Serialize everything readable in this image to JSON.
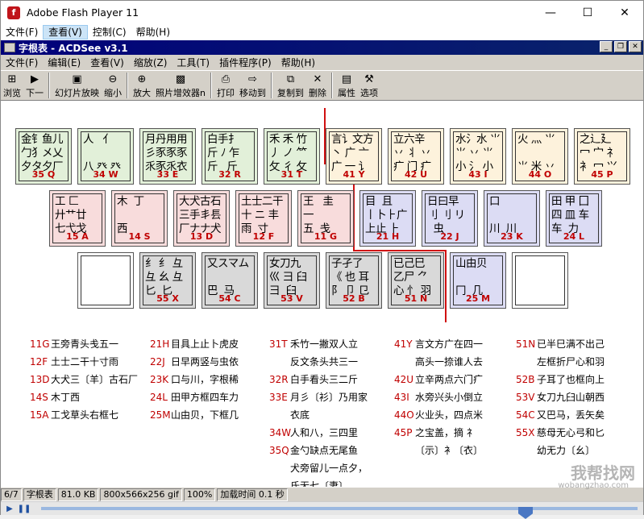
{
  "window": {
    "title": "Adobe Flash Player 11",
    "menu": [
      "文件(F)",
      "查看(V)",
      "控制(C)",
      "帮助(H)"
    ],
    "controls": {
      "minimize": "—",
      "maximize": "☐",
      "close": "✕"
    }
  },
  "acdsee": {
    "title": "字根表 - ACDSee v3.1",
    "menu": [
      "文件(F)",
      "编辑(E)",
      "查看(V)",
      "缩放(Z)",
      "工具(T)",
      "插件程序(P)",
      "帮助(H)"
    ],
    "toolbar": [
      {
        "label": "浏览",
        "icon": "browse-icon",
        "glyph": "⊞"
      },
      {
        "label": "下一",
        "icon": "next-icon",
        "glyph": "▶"
      },
      {
        "label": "幻灯片放映",
        "icon": "slideshow-icon",
        "glyph": "▣"
      },
      {
        "label": "缩小",
        "icon": "zoom-out-icon",
        "glyph": "⊖"
      },
      {
        "label": "放大",
        "icon": "zoom-in-icon",
        "glyph": "⊕"
      },
      {
        "label": "照片增效器n",
        "icon": "photo-enhancer-icon",
        "glyph": "▩"
      },
      {
        "label": "打印",
        "icon": "print-icon",
        "glyph": "⎙"
      },
      {
        "label": "移动到",
        "icon": "move-to-icon",
        "glyph": "⇨"
      },
      {
        "label": "复制到",
        "icon": "copy-to-icon",
        "glyph": "⧉"
      },
      {
        "label": "删除",
        "icon": "delete-icon",
        "glyph": "✕"
      },
      {
        "label": "属性",
        "icon": "properties-icon",
        "glyph": "▤"
      },
      {
        "label": "选项",
        "icon": "options-icon",
        "glyph": "⚒"
      }
    ]
  },
  "keyboard": {
    "row1": [
      {
        "code": "35 Q",
        "glyphs": "金钅鱼儿\n勹犭メ乂\n夕タ夕厂",
        "color": "green"
      },
      {
        "code": "34 W",
        "glyphs": "人   亻\n\n八 癶 癶",
        "color": "green"
      },
      {
        "code": "33 E",
        "glyphs": "月丹用用\n彡豕豕豕\n乑豕乑衣",
        "color": "green"
      },
      {
        "code": "32 R",
        "glyphs": "白手扌\n斤 ﾉ 乍\n斤   斤",
        "color": "green"
      },
      {
        "code": "31 T",
        "glyphs": "禾 禾 竹\n丿 ノ ⺮\n攵 彳 攵",
        "color": "green"
      },
      {
        "code": "41 Y",
        "glyphs": "言讠文方\n丶 广 亠\n广 一 讠",
        "color": "yellow"
      },
      {
        "code": "42 U",
        "glyphs": "立六辛\n丷 丬 丷\n疒 门 疒",
        "color": "yellow"
      },
      {
        "code": "43 I",
        "glyphs": "水氵水 ⺌\n⺌ 丷 ⺌\n小 氵 小",
        "color": "yellow"
      },
      {
        "code": "44 O",
        "glyphs": "火 灬 ⺌\n\n⺌ 米 丷",
        "color": "yellow"
      },
      {
        "code": "45 P",
        "glyphs": "之辶廴\n冖 宀 礻\n衤 冖 ⺍",
        "color": "yellow"
      }
    ],
    "row2": [
      {
        "code": "15 A",
        "glyphs": "工 匚\n廾艹廿\n七弋戈",
        "color": "pink"
      },
      {
        "code": "14 S",
        "glyphs": "木  丁\n\n西",
        "color": "pink"
      },
      {
        "code": "13 D",
        "glyphs": "大犬古石\n三手丯镸\n厂ナナ犬",
        "color": "pink"
      },
      {
        "code": "12 F",
        "glyphs": "土士二干\n十 ニ 丰\n雨  寸",
        "color": "pink"
      },
      {
        "code": "11 G",
        "glyphs": "王   圭\n一\n五  戋",
        "color": "pink"
      },
      {
        "code": "21 H",
        "glyphs": "目  且\n丨卜⺊广\n上止 ⺊",
        "color": "blue"
      },
      {
        "code": "22 J",
        "glyphs": "日曰早\n刂 刂 リ\n  虫",
        "color": "blue"
      },
      {
        "code": "23 K",
        "glyphs": "口\n\n川  川",
        "color": "blue"
      },
      {
        "code": "24 L",
        "glyphs": "田 甲 囗\n四 皿 车\n车  力",
        "color": "blue"
      }
    ],
    "row3": [
      {
        "code": "",
        "glyphs": "",
        "color": "white"
      },
      {
        "code": "55 X",
        "glyphs": "纟 纟 彑\n彑 幺 彑\n匕  匕",
        "color": "gray"
      },
      {
        "code": "54 C",
        "glyphs": "又スマム\n\n巴  马",
        "color": "gray"
      },
      {
        "code": "53 V",
        "glyphs": "女刀九\n巛 彐 臼\n彐  臼",
        "color": "gray"
      },
      {
        "code": "52 B",
        "glyphs": "子孑了\n《 也 耳\n阝 卩 㔾",
        "color": "gray"
      },
      {
        "code": "51 N",
        "glyphs": "已己巳\n乙尸 ⺈\n心 忄 羽",
        "color": "gray"
      },
      {
        "code": "25 M",
        "glyphs": "山由贝\n\n冂  几",
        "color": "blue"
      },
      {
        "code": "",
        "glyphs": "",
        "color": "white"
      }
    ]
  },
  "legend": {
    "col1": [
      {
        "code": "11G",
        "text": "王旁青头戋五一"
      },
      {
        "code": "12F",
        "text": "土士二干十寸雨"
      },
      {
        "code": "13D",
        "text": "大犬三〔羊〕古石厂"
      },
      {
        "code": "14S",
        "text": "木丁西"
      },
      {
        "code": "15A",
        "text": "工戈草头右框七"
      }
    ],
    "col2": [
      {
        "code": "21H",
        "text": "目具上止卜虎皮"
      },
      {
        "code": "22J",
        "text": "日早两竖与虫依"
      },
      {
        "code": "23K",
        "text": "口与川，字根稀"
      },
      {
        "code": "24L",
        "text": "田甲方框四车力"
      },
      {
        "code": "25M",
        "text": "山由贝，下框几"
      }
    ],
    "col3": [
      {
        "code": "31T",
        "text": "禾竹一撇双人立"
      },
      {
        "code": "",
        "text": "反文条头共三一"
      },
      {
        "code": "32R",
        "text": "白手看头三二斤"
      },
      {
        "code": "33E",
        "text": "月彡〔衫〕乃用家"
      },
      {
        "code": "",
        "text": "衣底"
      },
      {
        "code": "34W",
        "text": "人和八，三四里"
      },
      {
        "code": "35Q",
        "text": "金勺缺点无尾鱼"
      },
      {
        "code": "",
        "text": "犬旁留儿一点夕，"
      },
      {
        "code": "",
        "text": "氏无七〔妻〕"
      }
    ],
    "col4": [
      {
        "code": "41Y",
        "text": "言文方广在四一"
      },
      {
        "code": "",
        "text": "高头一捺谁人去"
      },
      {
        "code": "42U",
        "text": "立辛两点六门疒"
      },
      {
        "code": "43I",
        "text": "水旁兴头小倒立"
      },
      {
        "code": "44O",
        "text": "火业头，四点米"
      },
      {
        "code": "45P",
        "text": "之宝盖，摘 礻"
      },
      {
        "code": "",
        "text": "〔示〕衤〔衣〕"
      }
    ],
    "col5": [
      {
        "code": "51N",
        "text": "已半巳满不出己"
      },
      {
        "code": "",
        "text": "左框折尸心和羽"
      },
      {
        "code": "52B",
        "text": "子耳了也框向上"
      },
      {
        "code": "53V",
        "text": "女刀九臼山朝西"
      },
      {
        "code": "54C",
        "text": "又巴马，丢矢矣"
      },
      {
        "code": "55X",
        "text": "慈母无心弓和匕"
      },
      {
        "code": "",
        "text": "幼无力〔幺〕"
      }
    ]
  },
  "status": {
    "page": "6/7",
    "name": "字根表",
    "size": "81.0 KB",
    "dims": "800x566x256 gif",
    "zoom": "100%",
    "load": "加载时间 0.1 秒"
  },
  "watermark": {
    "text": "我帮找网",
    "url": "wobangzhao.com"
  },
  "colors": {
    "green": "#e2f0d9",
    "yellow": "#fdf2dc",
    "pink": "#f8dcdc",
    "blue": "#dcdcf4",
    "gray": "#d9d9d9",
    "accent_red": "#c00000"
  }
}
